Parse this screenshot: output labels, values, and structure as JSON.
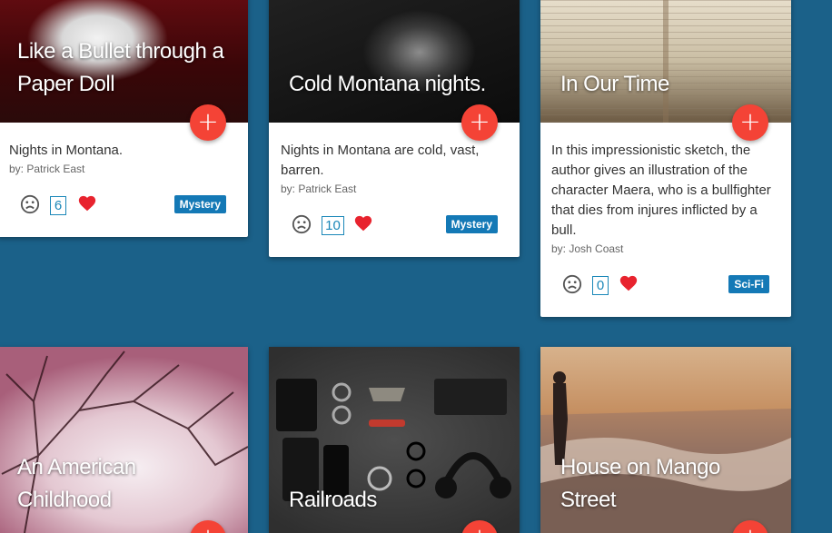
{
  "cards": [
    {
      "title": "Like a Bullet through a Paper Doll",
      "description": "Nights in Montana.",
      "author": "by: Patrick East",
      "count": "6",
      "genre": "Mystery"
    },
    {
      "title": "Cold Montana nights.",
      "description": "Nights in Montana are cold, vast, barren.",
      "author": "by: Patrick East",
      "count": "10",
      "genre": "Mystery"
    },
    {
      "title": "In Our Time",
      "description": "In this impressionistic sketch, the author gives an illustration of the character Maera, who is a bullfighter that dies from injures inflicted by a bull.",
      "author": "by: Josh Coast",
      "count": "0",
      "genre": "Sci-Fi"
    },
    {
      "title": "An American Childhood"
    },
    {
      "title": "Railroads"
    },
    {
      "title": "House on Mango Street"
    }
  ],
  "colors": {
    "background": "#1b6189",
    "fab": "#f44336",
    "badge": "#1479b6",
    "heart": "#e8232e",
    "count_border": "#1a87b8"
  },
  "icons": {
    "fab": "plus-icon",
    "dislike": "sad-face-icon",
    "like": "heart-icon"
  }
}
